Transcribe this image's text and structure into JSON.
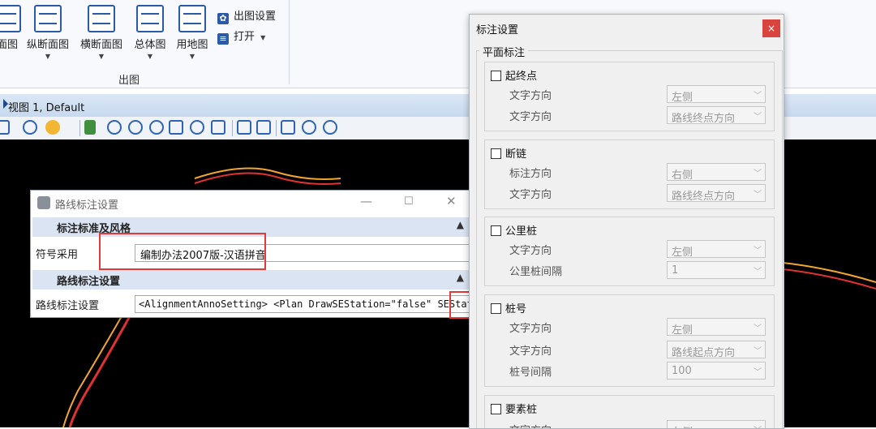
{
  "ribbon": {
    "buttons": [
      {
        "label": "面图",
        "has_dropdown": false,
        "icon": "plan-view-icon"
      },
      {
        "label": "纵断面图",
        "has_dropdown": true,
        "icon": "profile-view-icon"
      },
      {
        "label": "横断面图",
        "has_dropdown": true,
        "icon": "cross-section-icon"
      },
      {
        "label": "总体图",
        "has_dropdown": true,
        "icon": "overall-view-icon"
      },
      {
        "label": "用地图",
        "has_dropdown": true,
        "icon": "land-use-icon"
      }
    ],
    "output_settings_label": "出图设置",
    "open_label": "打开",
    "group_label": "出图"
  },
  "view": {
    "title": "视图 1, Default"
  },
  "route_dialog": {
    "title": "路线标注设置",
    "section1_title": "标注标准及风格",
    "symbol_label": "符号采用",
    "symbol_value": "编制办法2007版-汉语拼音",
    "section2_title": "路线标注设置",
    "route_label": "路线标注设置",
    "route_value": "<AlignmentAnnoSetting>  <Plan DrawSEStation=\"false\" SEStat",
    "ellipsis_label": "..."
  },
  "anno_dialog": {
    "title": "标注设置",
    "close_label": "×",
    "group_title": "平面标注",
    "panels": [
      {
        "title": "起终点",
        "checked": false,
        "rows": [
          {
            "label": "文字方向",
            "value": "左侧"
          },
          {
            "label": "文字方向",
            "value": "路线终点方向"
          }
        ]
      },
      {
        "title": "断链",
        "checked": false,
        "rows": [
          {
            "label": "标注方向",
            "value": "右侧"
          },
          {
            "label": "文字方向",
            "value": "路线终点方向"
          }
        ]
      },
      {
        "title": "公里桩",
        "checked": false,
        "rows": [
          {
            "label": "文字方向",
            "value": "左侧"
          },
          {
            "label": "公里桩间隔",
            "value": "1"
          }
        ]
      },
      {
        "title": "桩号",
        "checked": false,
        "rows": [
          {
            "label": "文字方向",
            "value": "左侧"
          },
          {
            "label": "文字方向",
            "value": "路线起点方向"
          },
          {
            "label": "桩号间隔",
            "value": "100"
          }
        ]
      },
      {
        "title": "要素桩",
        "checked": false,
        "rows": [
          {
            "label": "文字方向",
            "value": "左侧"
          }
        ]
      }
    ]
  },
  "colors": {
    "canvas_bg": "#000000",
    "road_orange": "#f2a630",
    "road_red": "#e03232",
    "highlight_red": "#e03a3a",
    "section_blue": "#dae4f2",
    "close_red": "#d9443e"
  }
}
